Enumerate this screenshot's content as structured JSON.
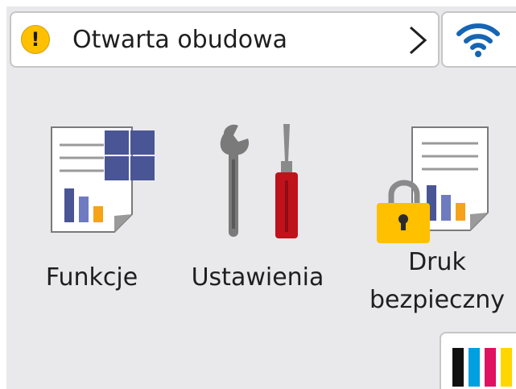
{
  "status": {
    "message": "Otwarta obudowa",
    "warning_glyph": "!",
    "icon": "warning-icon",
    "warning_color": "#ffc000"
  },
  "wifi": {
    "icon": "wifi-icon",
    "color": "#1565b4"
  },
  "tiles": [
    {
      "label": "Funkcje",
      "icon": "functions-icon"
    },
    {
      "label": "Ustawienia",
      "icon": "settings-icon"
    },
    {
      "label_line1": "Druk",
      "label_line2": "bezpieczny",
      "icon": "secure-print-icon"
    }
  ],
  "ink": {
    "icon": "ink-levels-icon",
    "colors": [
      "#111111",
      "#00a0e0",
      "#e0115f",
      "#ffd600"
    ]
  }
}
